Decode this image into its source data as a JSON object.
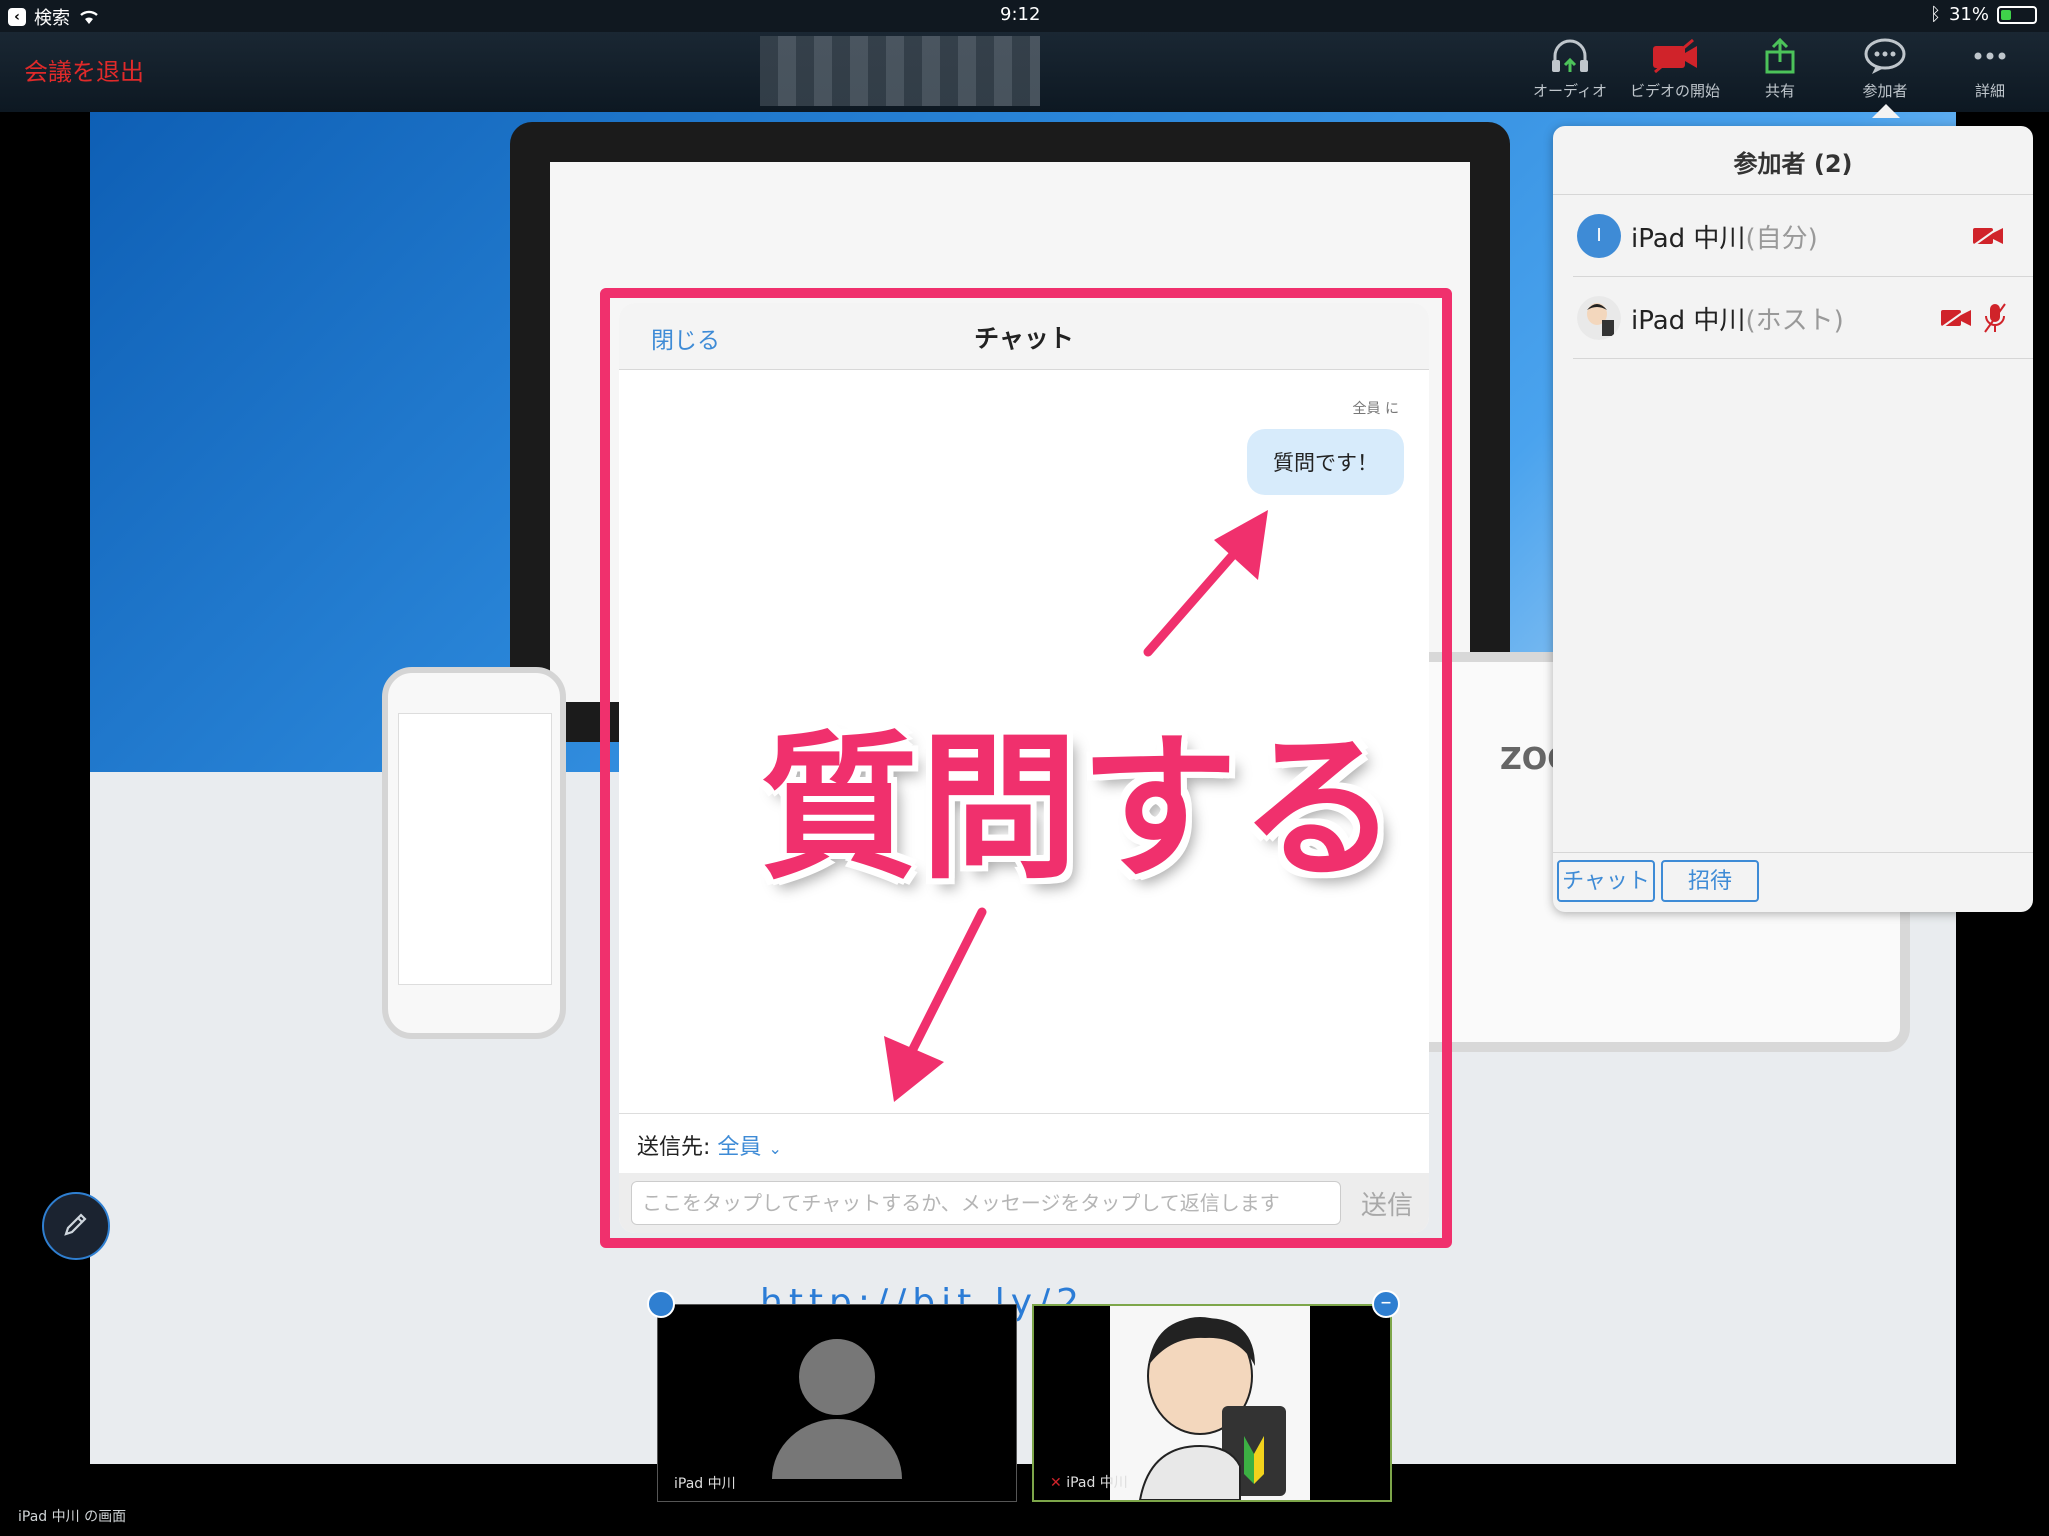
{
  "status_bar": {
    "back_label": "検索",
    "time": "9:12",
    "battery": "31%",
    "battery_level": 0.31
  },
  "toolbar": {
    "leave_label": "会議を退出",
    "items": [
      {
        "label": "オーディオ",
        "icon": "headphones-icon"
      },
      {
        "label": "ビデオの開始",
        "icon": "video-off-icon"
      },
      {
        "label": "共有",
        "icon": "share-icon"
      },
      {
        "label": "参加者",
        "icon": "participants-icon"
      },
      {
        "label": "詳細",
        "icon": "more-icon"
      }
    ]
  },
  "participants": {
    "title": "参加者 (2)",
    "list": [
      {
        "name": "iPad 中川",
        "suffix": "(自分)",
        "avatar_initial": "I"
      },
      {
        "name": "iPad 中川",
        "suffix": "(ホスト)"
      }
    ],
    "chat_button": "チャット",
    "invite_button": "招待"
  },
  "chat": {
    "close_label": "閉じる",
    "title": "チャット",
    "recipient_label": "全員 に",
    "messages": [
      {
        "text": "質問です！"
      }
    ],
    "send_to_label": "送信先:",
    "send_to_value": "全員",
    "input_placeholder": "ここをタップしてチャットするか、メッセージをタップして返信します",
    "send_button": "送信"
  },
  "annotation_text": "質問する",
  "shared_screen": {
    "partial_url": "http://bit.ly/2...",
    "brand_fragment": "ZOO"
  },
  "video_thumbs": [
    {
      "name": "iPad 中川"
    },
    {
      "name": "iPad 中川"
    }
  ],
  "screen_owner_label": "iPad 中川 の画面",
  "colors": {
    "accent": "#3e8bd6",
    "highlight": "#f0306d",
    "leave": "#e02a2a",
    "bubble": "#d7ebfb"
  }
}
